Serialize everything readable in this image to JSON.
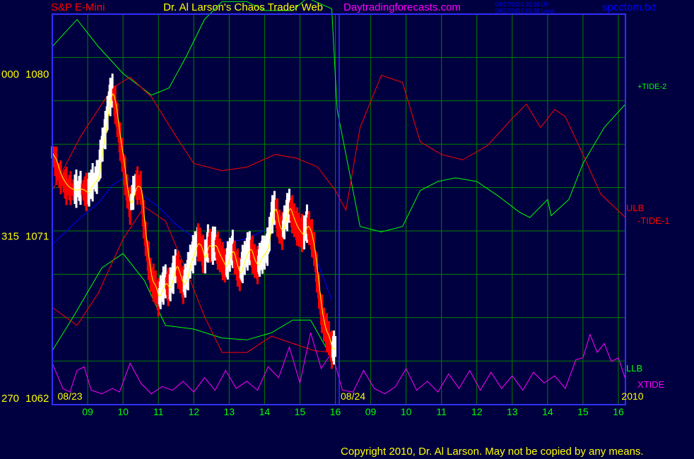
{
  "header": {
    "symbol": "S&P E-Mini",
    "title": "Dr. Al Larson's Chaos Trader Web",
    "site": "Daytradingforecasts.com",
    "time_ut": "08/27/2010 20:30 UT",
    "time_local": "08/27/2010 15:30 Local",
    "file": "spcctom.txt"
  },
  "footer": {
    "copyright": "Copyright 2010, Dr. Al Larson. May not be copied by any means."
  },
  "colors": {
    "background": "#000040",
    "grid": "#008000",
    "border": "#3030ff",
    "price_up": "#ffffff",
    "price_down": "#ff0000",
    "ulb": "#ff0000",
    "llb": "#00ff00",
    "tide": "#00ff00",
    "xtide": "#ff00ff",
    "fast_ma": "#ffff00",
    "slow_ma": "#0000ff"
  },
  "chart_data": {
    "type": "line",
    "axes": {
      "y_left_labels": [
        {
          "value": 1080,
          "text": "1080",
          "prefix": "000"
        },
        {
          "value": 1071,
          "text": "1071",
          "prefix": "315"
        },
        {
          "value": 1062,
          "text": "1062",
          "prefix": "270"
        }
      ],
      "x_hours": [
        {
          "x": 1,
          "label": "09"
        },
        {
          "x": 2,
          "label": "10"
        },
        {
          "x": 3,
          "label": "11"
        },
        {
          "x": 4,
          "label": "12"
        },
        {
          "x": 5,
          "label": "13"
        },
        {
          "x": 6,
          "label": "14"
        },
        {
          "x": 7,
          "label": "15"
        },
        {
          "x": 8,
          "label": "16"
        },
        {
          "x": 9,
          "label": "09"
        },
        {
          "x": 10,
          "label": "10"
        },
        {
          "x": 11,
          "label": "11"
        },
        {
          "x": 12,
          "label": "12"
        },
        {
          "x": 13,
          "label": "13"
        },
        {
          "x": 14,
          "label": "14"
        },
        {
          "x": 15,
          "label": "15"
        },
        {
          "x": 16,
          "label": "16"
        }
      ],
      "date_labels": [
        {
          "x": 0.5,
          "text": "08/23"
        },
        {
          "x": 8.5,
          "text": "08/24"
        },
        {
          "x": 16.4,
          "text": "2010"
        }
      ],
      "xlim": [
        0,
        16.2
      ],
      "ylim": [
        1061.6,
        1083.3
      ],
      "grid": true
    },
    "series_labels": [
      {
        "text": "+TIDE-2",
        "color": "#00ff00",
        "y": 1079.3
      },
      {
        "text": "ULB",
        "color": "#ff0000",
        "y": 1072.5
      },
      {
        "text": "-TIDE-1",
        "color": "#ff0000",
        "y": 1071.8
      },
      {
        "text": "LLB",
        "color": "#00ff00",
        "y": 1063.6
      },
      {
        "text": "XTIDE",
        "color": "#ff00ff",
        "y": 1062.7
      }
    ],
    "series": [
      {
        "name": "+TIDE-2",
        "color": "#00ff00",
        "points": [
          [
            0,
            1081.5
          ],
          [
            0.7,
            1083
          ],
          [
            1.3,
            1081.5
          ],
          [
            2,
            1080
          ],
          [
            2.8,
            1078.8
          ],
          [
            3.3,
            1079.2
          ],
          [
            3.8,
            1081
          ],
          [
            4.3,
            1083
          ],
          [
            4.8,
            1084
          ],
          [
            5.5,
            1084
          ],
          [
            6,
            1083.5
          ],
          [
            6.8,
            1083.5
          ],
          [
            7.2,
            1084.2
          ],
          [
            7.9,
            1083.6
          ],
          [
            8.05,
            1078
          ],
          [
            8.7,
            1071.5
          ],
          [
            9.3,
            1071.2
          ],
          [
            9.9,
            1071.5
          ],
          [
            10.4,
            1073.5
          ],
          [
            10.9,
            1074
          ],
          [
            11.4,
            1074.2
          ],
          [
            12,
            1074
          ],
          [
            12.6,
            1073.2
          ],
          [
            13.2,
            1072.3
          ],
          [
            13.5,
            1072
          ],
          [
            14,
            1073
          ],
          [
            14.1,
            1072.1
          ],
          [
            14.6,
            1073
          ],
          [
            15,
            1075
          ],
          [
            15.6,
            1077
          ],
          [
            16.2,
            1078.3
          ]
        ]
      },
      {
        "name": "ULB",
        "color": "#ff0000",
        "points": [
          [
            0,
            1073.5
          ],
          [
            0.8,
            1076.5
          ],
          [
            1.7,
            1079.2
          ],
          [
            2.2,
            1079.8
          ],
          [
            2.8,
            1078.7
          ],
          [
            3.5,
            1076.5
          ],
          [
            4,
            1075
          ],
          [
            4.8,
            1074.6
          ],
          [
            5.5,
            1074.8
          ],
          [
            6.3,
            1075.5
          ],
          [
            6.9,
            1075.3
          ],
          [
            7.5,
            1074.8
          ],
          [
            8,
            1073.5
          ],
          [
            8.3,
            1072.4
          ],
          [
            8.7,
            1077
          ],
          [
            9.3,
            1079.9
          ],
          [
            9.9,
            1079.5
          ],
          [
            10.4,
            1076.2
          ],
          [
            11,
            1075.5
          ],
          [
            11.6,
            1075.2
          ],
          [
            12.3,
            1076
          ],
          [
            13,
            1077.5
          ],
          [
            13.4,
            1078.3
          ],
          [
            13.8,
            1077
          ],
          [
            14.2,
            1078
          ],
          [
            14.5,
            1077.6
          ],
          [
            15,
            1075.5
          ],
          [
            15.5,
            1073.3
          ],
          [
            16.2,
            1072
          ]
        ]
      },
      {
        "name": "LLB",
        "color": "#00ff00",
        "points": [
          [
            0,
            1064.6
          ],
          [
            0.6,
            1066.5
          ],
          [
            1.4,
            1069.2
          ],
          [
            2,
            1070
          ],
          [
            2.6,
            1068.5
          ],
          [
            3.2,
            1066
          ],
          [
            4,
            1065.8
          ],
          [
            4.8,
            1065.3
          ],
          [
            5.5,
            1065.2
          ],
          [
            6.2,
            1065.6
          ],
          [
            6.8,
            1066.3
          ],
          [
            7.3,
            1066.3
          ],
          [
            7.9,
            1064.2
          ]
        ]
      },
      {
        "name": "red-lower",
        "color": "#ff0000",
        "points": [
          [
            0,
            1067
          ],
          [
            0.7,
            1066
          ],
          [
            1.3,
            1067.8
          ],
          [
            2,
            1070.8
          ],
          [
            2.6,
            1072.6
          ],
          [
            3.2,
            1071.8
          ],
          [
            3.8,
            1069
          ],
          [
            4.3,
            1066.5
          ],
          [
            4.8,
            1064.5
          ],
          [
            5.5,
            1064.5
          ],
          [
            6.2,
            1065.4
          ],
          [
            6.8,
            1065
          ],
          [
            7.4,
            1064.6
          ],
          [
            7.9,
            1064.5
          ]
        ]
      },
      {
        "name": "slow-ma",
        "color": "#0000ff",
        "points": [
          [
            0,
            1070.5
          ],
          [
            0.8,
            1072
          ],
          [
            1.3,
            1072.8
          ],
          [
            1.7,
            1073.8
          ],
          [
            2.1,
            1074.3
          ],
          [
            2.5,
            1073.3
          ],
          [
            3,
            1072.6
          ],
          [
            3.5,
            1071.6
          ],
          [
            4,
            1070.9
          ],
          [
            4.8,
            1070.6
          ],
          [
            5.5,
            1070.8
          ],
          [
            6,
            1071.3
          ],
          [
            6.5,
            1071.8
          ],
          [
            7.1,
            1071.6
          ],
          [
            7.5,
            1069.5
          ],
          [
            7.9,
            1067.4
          ]
        ]
      }
    ],
    "xtide": {
      "name": "XTIDE",
      "color": "#ff00ff",
      "points": [
        [
          0,
          1063.9
        ],
        [
          0.3,
          1062.5
        ],
        [
          0.5,
          1062.3
        ],
        [
          0.7,
          1063.5
        ],
        [
          0.9,
          1063.7
        ],
        [
          1.1,
          1062.4
        ],
        [
          1.4,
          1062.2
        ],
        [
          1.7,
          1062.5
        ],
        [
          1.9,
          1062.3
        ],
        [
          2.2,
          1063.9
        ],
        [
          2.5,
          1062.8
        ],
        [
          2.8,
          1062.2
        ],
        [
          3.1,
          1062.6
        ],
        [
          3.4,
          1062.4
        ],
        [
          3.7,
          1062.9
        ],
        [
          4,
          1062.3
        ],
        [
          4.3,
          1063.1
        ],
        [
          4.6,
          1062.4
        ],
        [
          4.9,
          1063.5
        ],
        [
          5.2,
          1062.5
        ],
        [
          5.5,
          1062.9
        ],
        [
          5.8,
          1062.4
        ],
        [
          6.1,
          1063.7
        ],
        [
          6.4,
          1063.1
        ],
        [
          6.7,
          1064.8
        ],
        [
          7,
          1062.8
        ],
        [
          7.3,
          1065.6
        ],
        [
          7.6,
          1063.6
        ],
        [
          7.9,
          1064.5
        ],
        [
          8.2,
          1062.4
        ],
        [
          8.5,
          1062.3
        ],
        [
          8.8,
          1063.5
        ],
        [
          9.1,
          1062.5
        ],
        [
          9.4,
          1062.2
        ],
        [
          9.7,
          1062.6
        ],
        [
          10,
          1063.6
        ],
        [
          10.3,
          1062.4
        ],
        [
          10.6,
          1062.9
        ],
        [
          10.9,
          1062.3
        ],
        [
          11.2,
          1063.3
        ],
        [
          11.5,
          1062.5
        ],
        [
          11.8,
          1063.5
        ],
        [
          12.1,
          1062.4
        ],
        [
          12.4,
          1063.4
        ],
        [
          12.7,
          1062.5
        ],
        [
          13,
          1063.2
        ],
        [
          13.3,
          1062.4
        ],
        [
          13.6,
          1063.4
        ],
        [
          13.9,
          1062.8
        ],
        [
          14.2,
          1063.2
        ],
        [
          14.5,
          1062.5
        ],
        [
          14.8,
          1064.1
        ],
        [
          15,
          1064.2
        ],
        [
          15.2,
          1065.5
        ],
        [
          15.4,
          1064.5
        ],
        [
          15.6,
          1065
        ],
        [
          15.8,
          1064
        ],
        [
          16,
          1064.2
        ],
        [
          16.2,
          1063
        ]
      ]
    },
    "price": {
      "name": "Price",
      "up_color": "#ffffff",
      "down_color": "#ff0000",
      "points": [
        [
          0,
          1075.6
        ],
        [
          0.2,
          1074.3
        ],
        [
          0.4,
          1073.7
        ],
        [
          0.6,
          1073.5
        ],
        [
          0.8,
          1073.6
        ],
        [
          1,
          1073.3
        ],
        [
          1.1,
          1073.8
        ],
        [
          1.3,
          1074.3
        ],
        [
          1.4,
          1075.8
        ],
        [
          1.5,
          1076.8
        ],
        [
          1.6,
          1078.4
        ],
        [
          1.7,
          1079
        ],
        [
          1.8,
          1078
        ],
        [
          1.9,
          1076.4
        ],
        [
          2,
          1075.2
        ],
        [
          2.1,
          1073.6
        ],
        [
          2.2,
          1072.6
        ],
        [
          2.35,
          1073.8
        ],
        [
          2.5,
          1073.6
        ],
        [
          2.6,
          1071.4
        ],
        [
          2.7,
          1069.8
        ],
        [
          2.8,
          1068.5
        ],
        [
          2.9,
          1068.2
        ],
        [
          3,
          1067.5
        ],
        [
          3.1,
          1068
        ],
        [
          3.2,
          1068.4
        ],
        [
          3.3,
          1068
        ],
        [
          3.4,
          1068.6
        ],
        [
          3.5,
          1069.4
        ],
        [
          3.6,
          1068.8
        ],
        [
          3.7,
          1068.2
        ],
        [
          3.8,
          1068.6
        ],
        [
          3.9,
          1069.5
        ],
        [
          4,
          1070
        ],
        [
          4.1,
          1070.6
        ],
        [
          4.2,
          1070.4
        ],
        [
          4.3,
          1069.6
        ],
        [
          4.4,
          1070.5
        ],
        [
          4.5,
          1070.3
        ],
        [
          4.6,
          1070.5
        ],
        [
          4.7,
          1070
        ],
        [
          4.8,
          1069.6
        ],
        [
          4.9,
          1069.2
        ],
        [
          5,
          1069.8
        ],
        [
          5.1,
          1070.2
        ],
        [
          5.2,
          1069.4
        ],
        [
          5.3,
          1068.8
        ],
        [
          5.4,
          1069.5
        ],
        [
          5.5,
          1070
        ],
        [
          5.6,
          1070.3
        ],
        [
          5.7,
          1069.6
        ],
        [
          5.8,
          1069.3
        ],
        [
          5.9,
          1069.8
        ],
        [
          6,
          1070
        ],
        [
          6.1,
          1070.4
        ],
        [
          6.2,
          1072
        ],
        [
          6.3,
          1072.6
        ],
        [
          6.4,
          1071.5
        ],
        [
          6.5,
          1071.2
        ],
        [
          6.6,
          1072
        ],
        [
          6.7,
          1072.6
        ],
        [
          6.8,
          1072
        ],
        [
          6.9,
          1071.5
        ],
        [
          7,
          1071.2
        ],
        [
          7.1,
          1071
        ],
        [
          7.2,
          1071.6
        ],
        [
          7.3,
          1071.2
        ],
        [
          7.4,
          1070.2
        ],
        [
          7.5,
          1068.5
        ],
        [
          7.6,
          1066.8
        ],
        [
          7.7,
          1065.8
        ],
        [
          7.8,
          1065.4
        ],
        [
          7.9,
          1064.6
        ],
        [
          8.0,
          1064.8
        ]
      ]
    }
  }
}
